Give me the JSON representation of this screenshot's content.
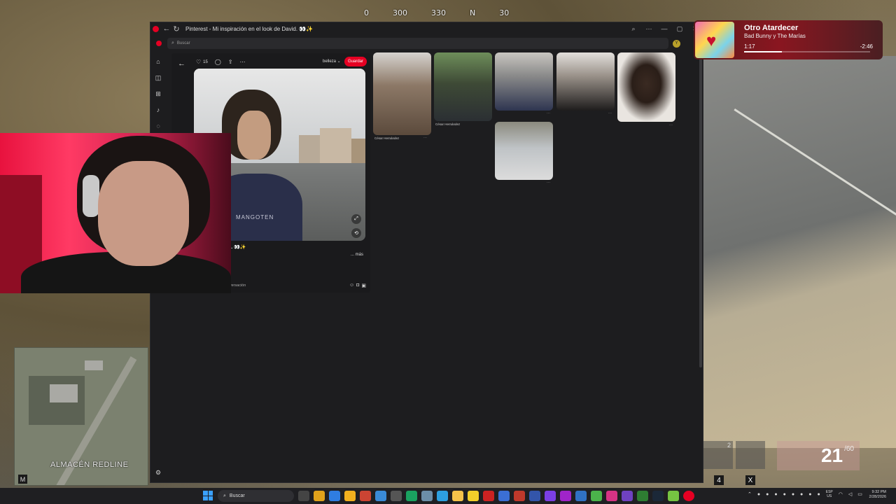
{
  "game": {
    "compass_ticks": [
      "0",
      "300",
      "330",
      "N",
      "30"
    ],
    "location": "ALMACÉN REDLINE",
    "map_key": "M",
    "slot2_count": "2",
    "slot_key_4": "4",
    "slot_key_x": "X",
    "ammo_current": "21",
    "ammo_reserve": "/60"
  },
  "browser": {
    "window_title": "Pinterest - Mi inspiración en el look de David. 👀✨",
    "search_placeholder": "Buscar",
    "profile_initial": "Y"
  },
  "pin": {
    "likes": "15",
    "board": "belleza",
    "save_label": "Guardar",
    "shirt_text": "MANGOTEN",
    "title": "el look de David. 👀✨",
    "more_label": "... más",
    "comments_label": "ntarios",
    "convo_placeholder": "no para iniciar la conversación"
  },
  "grid": {
    "cards": [
      {
        "caption": "César Hernández"
      },
      {
        "caption": "César Hernández"
      },
      {
        "caption": ""
      },
      {
        "caption": ""
      },
      {
        "caption": ""
      },
      {
        "caption": ""
      }
    ]
  },
  "music": {
    "song": "Otro Atardecer",
    "artist": "Bad Bunny y The Marías",
    "elapsed": "1:17",
    "remaining": "-2:46",
    "progress": 0.3
  },
  "taskbar": {
    "search_label": "Buscar",
    "lang_line1": "ESP",
    "lang_line2": "US",
    "time": "9:32 PM",
    "date": "2/28/2026"
  },
  "colors": {
    "pinterest_red": "#e60023",
    "browser_bg": "#1d1d1f"
  }
}
